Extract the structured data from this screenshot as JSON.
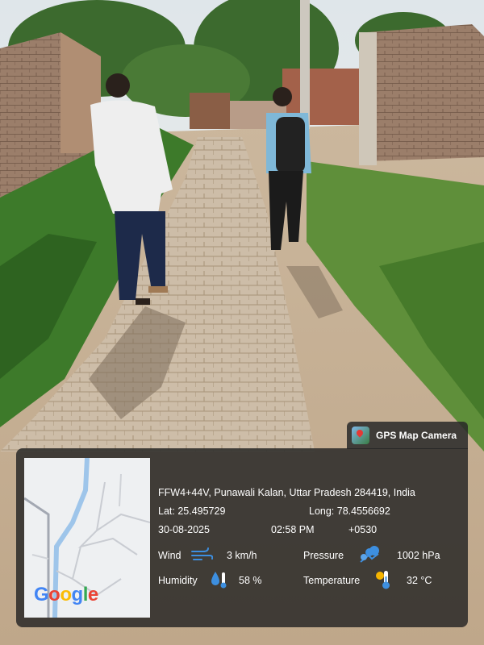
{
  "gps": {
    "app_name": "GPS Map Camera",
    "address": "FFW4+44V, Punawali Kalan, Uttar Pradesh 284419, India",
    "lat": "Lat: 25.495729",
    "long": "Long: 78.4556692",
    "date": "30-08-2025",
    "time": "02:58 PM",
    "tz": "+0530",
    "wind_label": "Wind",
    "wind_value": "3 km/h",
    "pressure_label": "Pressure",
    "pressure_value": "1002 hPa",
    "humidity_label": "Humidity",
    "humidity_value": "58 %",
    "temperature_label": "Temperature",
    "temperature_value": "32 °C",
    "map_brand": "Google"
  }
}
